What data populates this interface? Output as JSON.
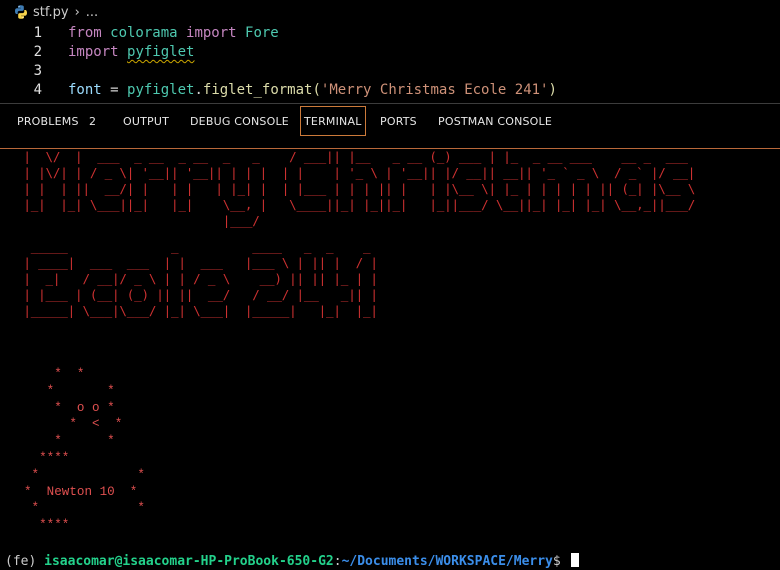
{
  "breadcrumb": {
    "file": "stf.py",
    "separator": "›",
    "ellipsis": "..."
  },
  "editor": {
    "lines": [
      {
        "number": "1",
        "tokens": {
          "a": "from",
          "b": " colorama ",
          "c": "import",
          "d": " Fore"
        }
      },
      {
        "number": "2",
        "tokens": {
          "a": "import",
          "b": " ",
          "c": "pyfiglet"
        }
      },
      {
        "number": "3"
      },
      {
        "number": "4",
        "tokens": {
          "a": "font",
          "b": " = ",
          "c": "pyfiglet",
          "d": ".",
          "e": "figlet_format",
          "f": "(",
          "g": "'Merry Christmas Ecole 241'",
          "h": ")"
        }
      }
    ]
  },
  "panel": {
    "tabs": [
      {
        "label": "PROBLEMS"
      },
      {
        "label": "OUTPUT"
      },
      {
        "label": "DEBUG CONSOLE"
      },
      {
        "label": "TERMINAL",
        "active": true
      },
      {
        "label": "PORTS"
      },
      {
        "label": "POSTMAN CONSOLE"
      }
    ],
    "problems_count": "2"
  },
  "terminal": {
    "figlet_line1": " |  \\/  |  ___  _ __  _ __  _   _    / ___|| |__   _ __ (_) ___ | |_  _ __ ___    __ _  ___ \n | |\\/| | / _ \\| '__|| '__|| | | |  | |    | '_ \\ | '__|| |/ __|| __|| '_ ` _ \\  / _` |/ __|\n | |  | ||  __/| |   | |   | |_| |  | |___ | | | || |   | |\\__ \\| |_ | | | | | || (_| |\\__ \\\n |_|  |_| \\___||_|   |_|    \\__, |   \\____||_| |_||_|   |_||___/ \\__||_| |_| |_| \\__,_||___/\n                            |___/",
    "figlet_line2": "  _____              _          ____   _  _    _ \n | ____|  ___  ___  | |  ___   |___ \\ | || |  / |\n |  _|   / __|/ _ \\ | | / _ \\    __) || || |_ | |\n | |___ | (__| (_) || ||  __/   / __/ |__   _|| |\n |_____| \\___|\\___/ |_| \\___|  |_____|   |_|  |_|",
    "ascii_art": "    *  *\n   *       *\n    *  o o *\n      *  <  *\n    *      *\n  ****\n *             *\n*  Newton 10  *\n *             *\n  ****",
    "prompt": {
      "env": "(fe) ",
      "user_host": "isaacomar@isaacomar-HP-ProBook-650-G2",
      "colon": ":",
      "path": "~/Documents/WORKSPACE/Merry",
      "dollar": "$ "
    }
  },
  "colors": {
    "figlet": "#cd3131",
    "keyword": "#c586c0",
    "module": "#4ec9b0",
    "string": "#ce9178",
    "prompt_user": "#23d18b",
    "prompt_path": "#3b8eea",
    "active_tab_border": "#cc7a3a"
  }
}
